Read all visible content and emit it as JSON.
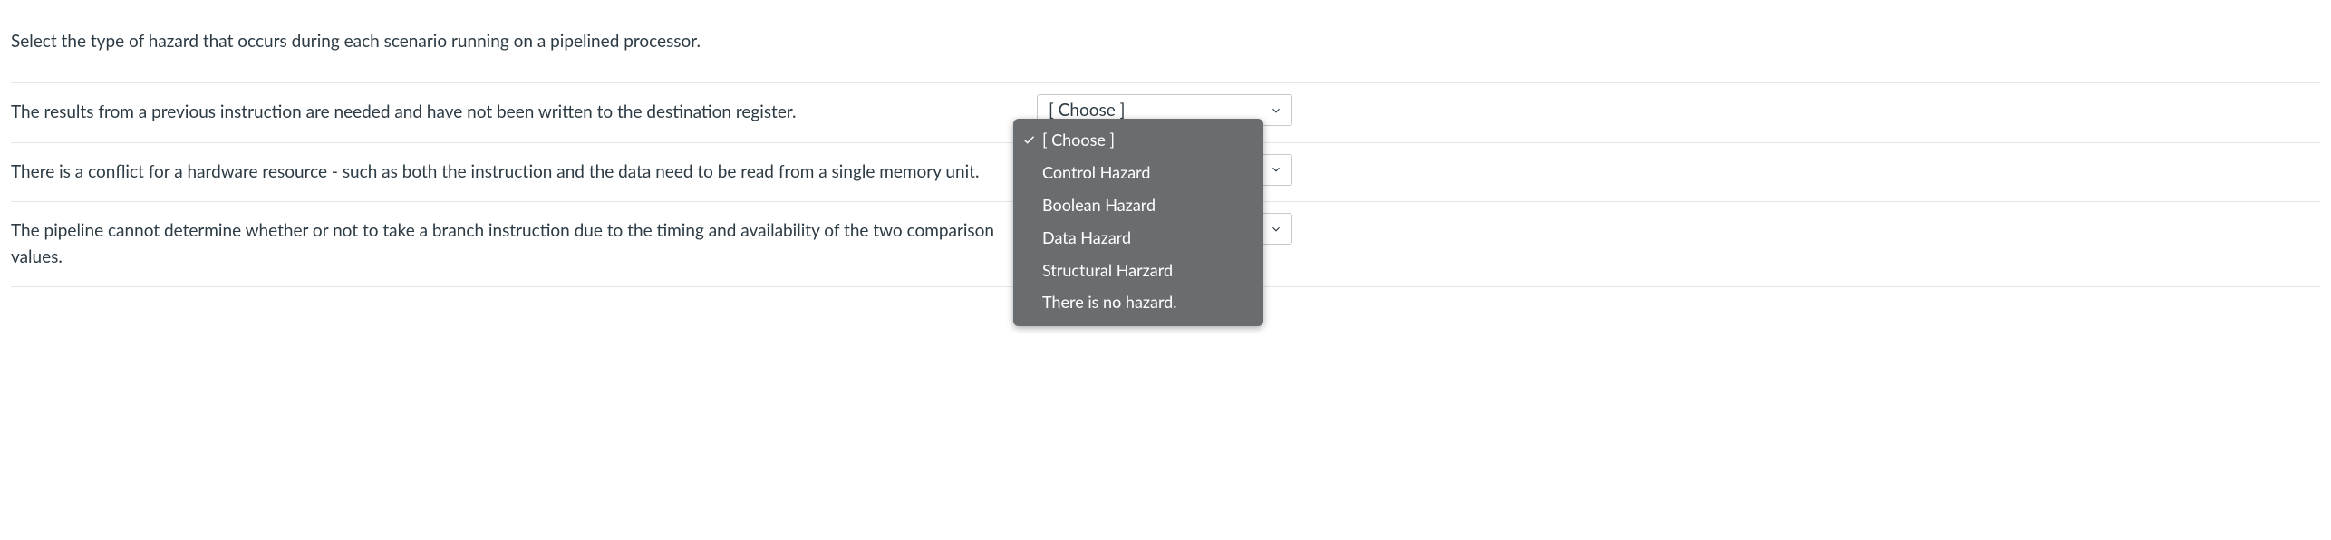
{
  "prompt": "Select the type of hazard that occurs during each scenario running on a pipelined processor.",
  "rows": [
    {
      "stem": "The results from a previous instruction are needed and have not been written to the destination register.",
      "selected": "[ Choose ]"
    },
    {
      "stem": "There is a conflict for a hardware resource - such as both the instruction and the data need to be read from a single memory unit.",
      "selected": "[ Choose ]"
    },
    {
      "stem": "The pipeline cannot determine whether or not to take a branch instruction due to the timing and availability of the two comparison values.",
      "selected": "[ Choose ]"
    }
  ],
  "dropdown": {
    "options": [
      "[ Choose ]",
      "Control Hazard",
      "Boolean Hazard",
      "Data Hazard",
      "Structural Harzard",
      "There is no hazard."
    ],
    "selected_index": 0
  }
}
